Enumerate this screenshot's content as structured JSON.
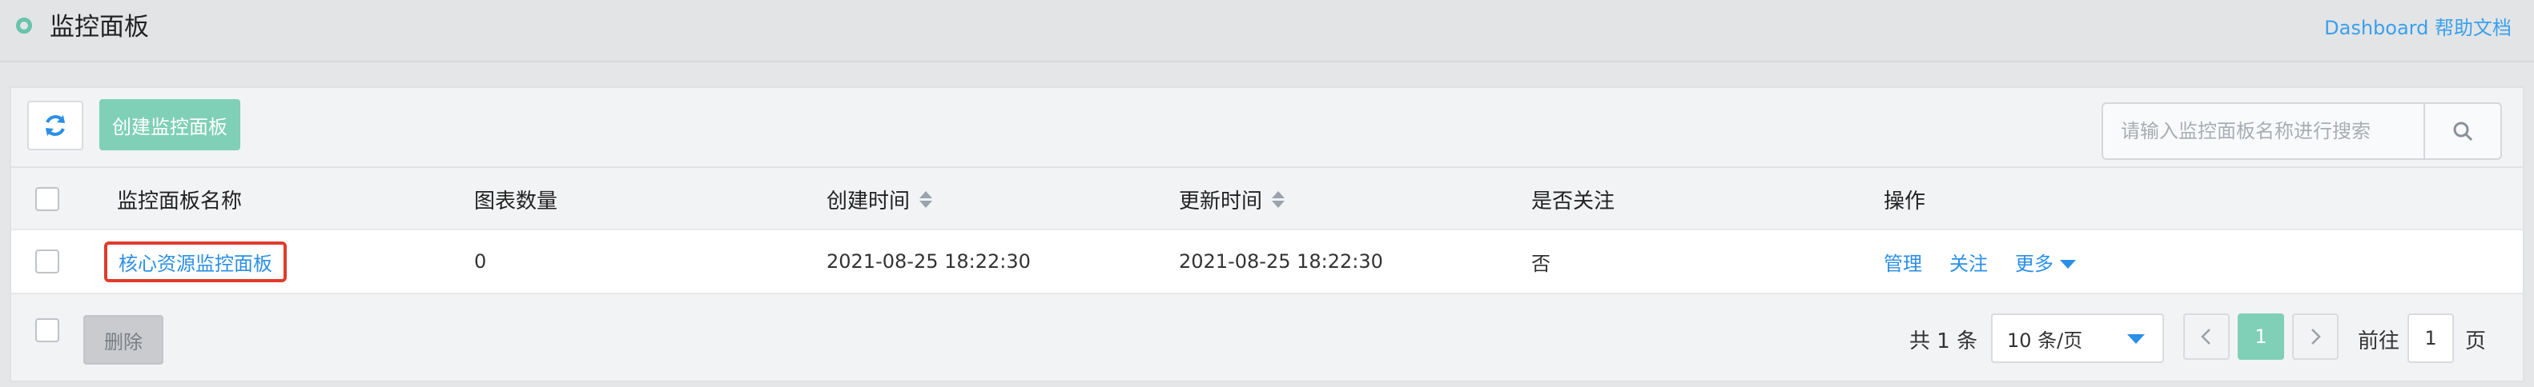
{
  "header": {
    "title": "监控面板",
    "help_link": "Dashboard 帮助文档"
  },
  "toolbar": {
    "refresh_icon": "refresh-icon",
    "create_label": "创建监控面板",
    "search_placeholder": "请输入监控面板名称进行搜索",
    "search_icon": "search-icon"
  },
  "table": {
    "columns": [
      "监控面板名称",
      "图表数量",
      "创建时间",
      "更新时间",
      "是否关注",
      "操作"
    ],
    "rows": [
      {
        "name": "核心资源监控面板",
        "chart_count": "0",
        "created": "2021-08-25 18:22:30",
        "updated": "2021-08-25 18:22:30",
        "followed": "否",
        "actions": [
          "管理",
          "关注",
          "更多"
        ]
      }
    ]
  },
  "footer": {
    "delete_label": "删除",
    "total": "共 1 条",
    "page_size": "10 条/页",
    "current_page": "1",
    "goto_prefix": "前往",
    "goto_value": "1",
    "goto_suffix": "页"
  },
  "colors": {
    "accent": "#7fd0b6",
    "link": "#2b8fe6",
    "highlight": "#e03b2b"
  }
}
